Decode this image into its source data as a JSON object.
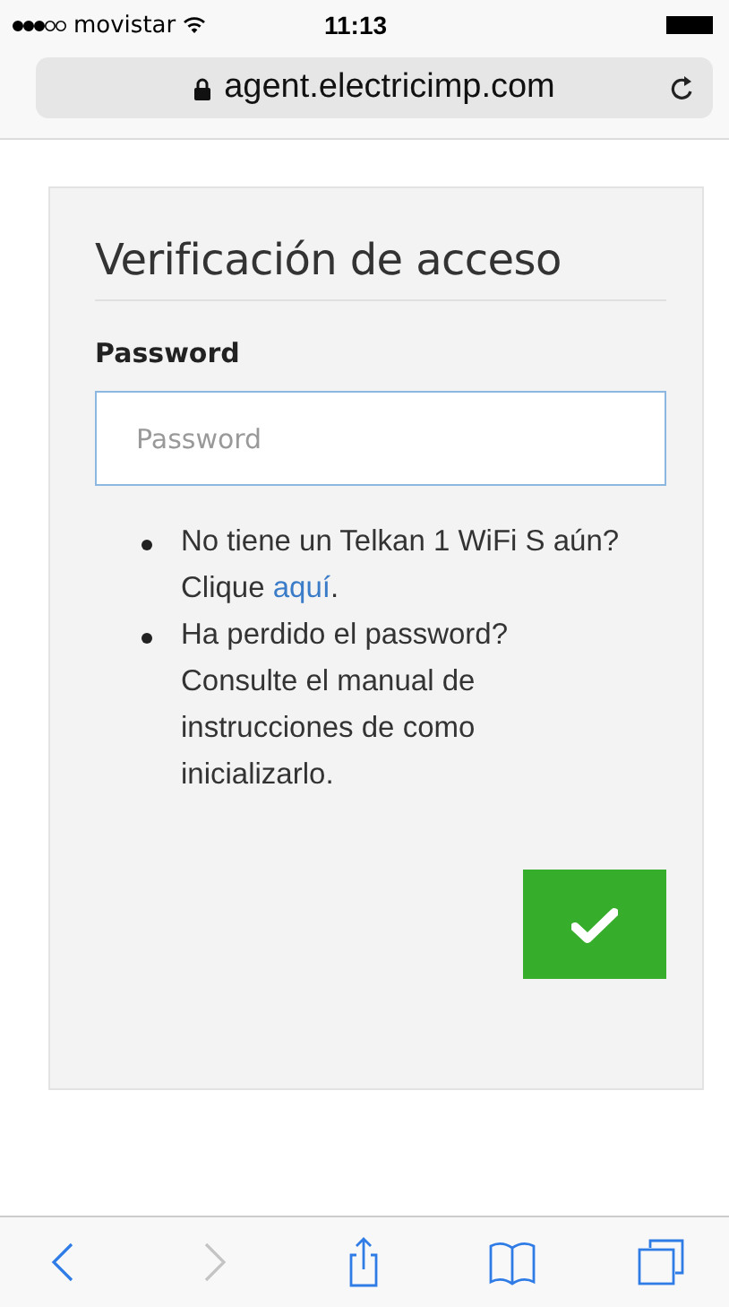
{
  "status_bar": {
    "carrier": "movistar",
    "time": "11:13"
  },
  "address_bar": {
    "url": "agent.electricimp.com",
    "secure": true
  },
  "form": {
    "title": "Verificación de acceso",
    "field_label": "Password",
    "password": {
      "placeholder": "Password"
    },
    "notes": [
      {
        "text": "No tiene un Telkan 1 WiFi S aún? Clique ",
        "link": "aquí",
        "after": "."
      },
      {
        "text": "Ha perdido el password? Consulte el manual de instrucciones de como inicializarlo."
      }
    ]
  },
  "toolbar": [
    {
      "kind": "back",
      "disabled": false
    },
    {
      "kind": "forward",
      "disabled": true
    },
    {
      "kind": "share",
      "disabled": false
    },
    {
      "kind": "bookmarks",
      "disabled": false
    },
    {
      "kind": "tabs",
      "disabled": false
    }
  ]
}
